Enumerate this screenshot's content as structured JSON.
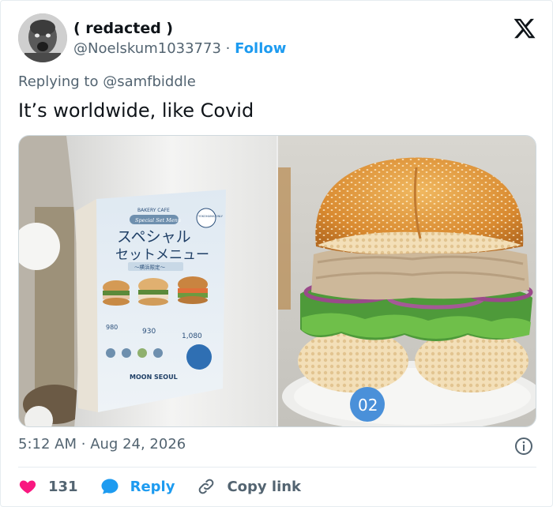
{
  "user": {
    "display_name": "( redacted )",
    "handle": "@Noelskum1033773",
    "separator": "·",
    "follow_label": "Follow"
  },
  "reply": {
    "prefix": "Replying to ",
    "mention": "@samfbiddle"
  },
  "tweet": {
    "text": "It’s worldwide, like Covid"
  },
  "media": {
    "poster_brand": "BAKERY CAFE",
    "poster_subtitle": "Special Set Menu",
    "poster_title_line1": "スペシャル",
    "poster_title_line2": "セットメニュー",
    "poster_tag": "～横浜限定～",
    "poster_badge": "YOKOHAMA ONLY",
    "poster_footer": "MOON SEOUL",
    "poster_prices": [
      "980",
      "930",
      "1,080"
    ],
    "photo_badge": "02"
  },
  "meta": {
    "time": "5:12 AM",
    "separator": "·",
    "date": "Aug 24, 2026"
  },
  "actions": {
    "like_count": "131",
    "reply_label": "Reply",
    "copy_label": "Copy link"
  },
  "colors": {
    "accent": "#1d9bf0",
    "like": "#f91880",
    "text": "#0f1419",
    "muted": "#536471"
  }
}
